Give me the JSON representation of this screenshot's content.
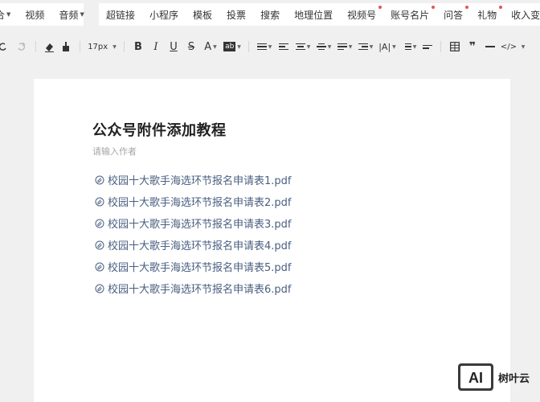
{
  "top_toolbar": {
    "left_group": [
      {
        "label": "合",
        "caret": true
      },
      {
        "label": "视频",
        "caret": false
      },
      {
        "label": "音频",
        "caret": true
      }
    ],
    "right_group": [
      {
        "label": "超链接",
        "caret": false,
        "dot": false
      },
      {
        "label": "小程序",
        "caret": false,
        "dot": false
      },
      {
        "label": "模板",
        "caret": false,
        "dot": false
      },
      {
        "label": "投票",
        "caret": false,
        "dot": false
      },
      {
        "label": "搜索",
        "caret": false,
        "dot": false
      },
      {
        "label": "地理位置",
        "caret": false,
        "dot": false
      },
      {
        "label": "视频号",
        "caret": false,
        "dot": true
      },
      {
        "label": "账号名片",
        "caret": false,
        "dot": true
      },
      {
        "label": "问答",
        "caret": false,
        "dot": true
      },
      {
        "label": "礼物",
        "caret": false,
        "dot": true
      },
      {
        "label": "收入变现",
        "caret": true,
        "dot": false
      }
    ]
  },
  "format_toolbar": {
    "font_size": "17px",
    "accent_red": "#e05a4f"
  },
  "document": {
    "title": "公众号附件添加教程",
    "author_placeholder": "请输入作者",
    "attachments": [
      "校园十大歌手海选环节报名申请表1.pdf",
      "校园十大歌手海选环节报名申请表2.pdf",
      "校园十大歌手海选环节报名申请表3.pdf",
      "校园十大歌手海选环节报名申请表4.pdf",
      "校园十大歌手海选环节报名申请表5.pdf",
      "校园十大歌手海选环节报名申请表6.pdf"
    ],
    "link_color": "#4a5f80"
  },
  "watermark": {
    "logo_text": "AI",
    "brand": "树叶云"
  }
}
